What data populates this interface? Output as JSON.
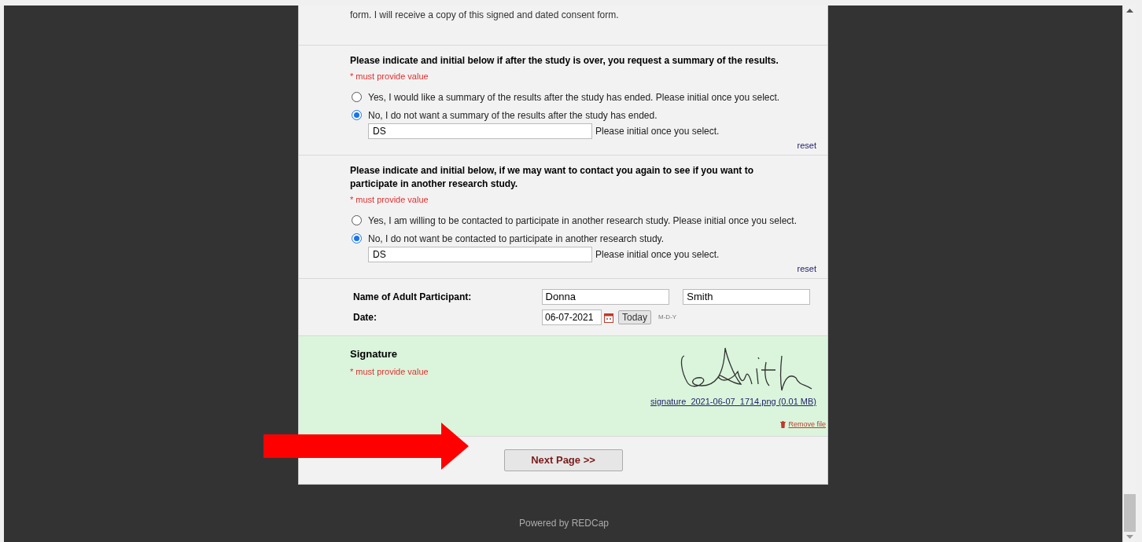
{
  "consent_text": "form. I will receive a copy of this signed and dated consent form.",
  "questions": [
    {
      "prompt": "Please indicate and initial below if after the study is over, you request a summary of the results.",
      "required_note": "* must provide value",
      "options": [
        {
          "label": "Yes, I would like a summary of the results after the study has ended. Please initial once you select.",
          "selected": false
        },
        {
          "label": "No, I do not want a summary of the results after the study has ended.",
          "selected": true
        }
      ],
      "initials": {
        "value": "DS",
        "hint": "Please initial once you select."
      },
      "reset": "reset"
    },
    {
      "prompt": "Please indicate and initial below, if we may want to contact you again to see if you want to participate in another research study.",
      "required_note": "* must provide value",
      "options": [
        {
          "label": "Yes, I am willing to be contacted to participate in another research study. Please initial once you select.",
          "selected": false
        },
        {
          "label": "No, I do not want be contacted to participate in another research study.",
          "selected": true
        }
      ],
      "initials": {
        "value": "DS",
        "hint": "Please initial once you select."
      },
      "reset": "reset"
    }
  ],
  "participant": {
    "name_label": "Name of Adult Participant:",
    "first_name": "Donna",
    "last_name": "Smith",
    "date_label": "Date:",
    "date": "06-07-2021",
    "today_button": "Today",
    "date_format": "M-D-Y"
  },
  "signature": {
    "label": "Signature",
    "required_note": "* must provide value",
    "file_link": "signature_2021-06-07_1714.png (0.01 MB)",
    "remove": "Remove file"
  },
  "next_button": "Next Page >>",
  "footer": "Powered by REDCap"
}
